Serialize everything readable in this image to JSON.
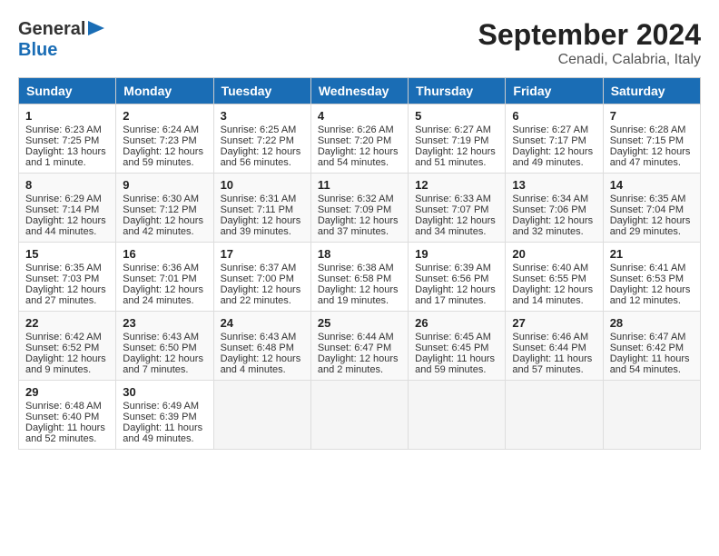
{
  "header": {
    "logo_line1": "General",
    "logo_line2": "Blue",
    "title": "September 2024",
    "subtitle": "Cenadi, Calabria, Italy"
  },
  "calendar": {
    "days_of_week": [
      "Sunday",
      "Monday",
      "Tuesday",
      "Wednesday",
      "Thursday",
      "Friday",
      "Saturday"
    ],
    "weeks": [
      [
        {
          "day": "1",
          "sunrise": "Sunrise: 6:23 AM",
          "sunset": "Sunset: 7:25 PM",
          "daylight": "Daylight: 13 hours and 1 minute."
        },
        {
          "day": "2",
          "sunrise": "Sunrise: 6:24 AM",
          "sunset": "Sunset: 7:23 PM",
          "daylight": "Daylight: 12 hours and 59 minutes."
        },
        {
          "day": "3",
          "sunrise": "Sunrise: 6:25 AM",
          "sunset": "Sunset: 7:22 PM",
          "daylight": "Daylight: 12 hours and 56 minutes."
        },
        {
          "day": "4",
          "sunrise": "Sunrise: 6:26 AM",
          "sunset": "Sunset: 7:20 PM",
          "daylight": "Daylight: 12 hours and 54 minutes."
        },
        {
          "day": "5",
          "sunrise": "Sunrise: 6:27 AM",
          "sunset": "Sunset: 7:19 PM",
          "daylight": "Daylight: 12 hours and 51 minutes."
        },
        {
          "day": "6",
          "sunrise": "Sunrise: 6:27 AM",
          "sunset": "Sunset: 7:17 PM",
          "daylight": "Daylight: 12 hours and 49 minutes."
        },
        {
          "day": "7",
          "sunrise": "Sunrise: 6:28 AM",
          "sunset": "Sunset: 7:15 PM",
          "daylight": "Daylight: 12 hours and 47 minutes."
        }
      ],
      [
        {
          "day": "8",
          "sunrise": "Sunrise: 6:29 AM",
          "sunset": "Sunset: 7:14 PM",
          "daylight": "Daylight: 12 hours and 44 minutes."
        },
        {
          "day": "9",
          "sunrise": "Sunrise: 6:30 AM",
          "sunset": "Sunset: 7:12 PM",
          "daylight": "Daylight: 12 hours and 42 minutes."
        },
        {
          "day": "10",
          "sunrise": "Sunrise: 6:31 AM",
          "sunset": "Sunset: 7:11 PM",
          "daylight": "Daylight: 12 hours and 39 minutes."
        },
        {
          "day": "11",
          "sunrise": "Sunrise: 6:32 AM",
          "sunset": "Sunset: 7:09 PM",
          "daylight": "Daylight: 12 hours and 37 minutes."
        },
        {
          "day": "12",
          "sunrise": "Sunrise: 6:33 AM",
          "sunset": "Sunset: 7:07 PM",
          "daylight": "Daylight: 12 hours and 34 minutes."
        },
        {
          "day": "13",
          "sunrise": "Sunrise: 6:34 AM",
          "sunset": "Sunset: 7:06 PM",
          "daylight": "Daylight: 12 hours and 32 minutes."
        },
        {
          "day": "14",
          "sunrise": "Sunrise: 6:35 AM",
          "sunset": "Sunset: 7:04 PM",
          "daylight": "Daylight: 12 hours and 29 minutes."
        }
      ],
      [
        {
          "day": "15",
          "sunrise": "Sunrise: 6:35 AM",
          "sunset": "Sunset: 7:03 PM",
          "daylight": "Daylight: 12 hours and 27 minutes."
        },
        {
          "day": "16",
          "sunrise": "Sunrise: 6:36 AM",
          "sunset": "Sunset: 7:01 PM",
          "daylight": "Daylight: 12 hours and 24 minutes."
        },
        {
          "day": "17",
          "sunrise": "Sunrise: 6:37 AM",
          "sunset": "Sunset: 7:00 PM",
          "daylight": "Daylight: 12 hours and 22 minutes."
        },
        {
          "day": "18",
          "sunrise": "Sunrise: 6:38 AM",
          "sunset": "Sunset: 6:58 PM",
          "daylight": "Daylight: 12 hours and 19 minutes."
        },
        {
          "day": "19",
          "sunrise": "Sunrise: 6:39 AM",
          "sunset": "Sunset: 6:56 PM",
          "daylight": "Daylight: 12 hours and 17 minutes."
        },
        {
          "day": "20",
          "sunrise": "Sunrise: 6:40 AM",
          "sunset": "Sunset: 6:55 PM",
          "daylight": "Daylight: 12 hours and 14 minutes."
        },
        {
          "day": "21",
          "sunrise": "Sunrise: 6:41 AM",
          "sunset": "Sunset: 6:53 PM",
          "daylight": "Daylight: 12 hours and 12 minutes."
        }
      ],
      [
        {
          "day": "22",
          "sunrise": "Sunrise: 6:42 AM",
          "sunset": "Sunset: 6:52 PM",
          "daylight": "Daylight: 12 hours and 9 minutes."
        },
        {
          "day": "23",
          "sunrise": "Sunrise: 6:43 AM",
          "sunset": "Sunset: 6:50 PM",
          "daylight": "Daylight: 12 hours and 7 minutes."
        },
        {
          "day": "24",
          "sunrise": "Sunrise: 6:43 AM",
          "sunset": "Sunset: 6:48 PM",
          "daylight": "Daylight: 12 hours and 4 minutes."
        },
        {
          "day": "25",
          "sunrise": "Sunrise: 6:44 AM",
          "sunset": "Sunset: 6:47 PM",
          "daylight": "Daylight: 12 hours and 2 minutes."
        },
        {
          "day": "26",
          "sunrise": "Sunrise: 6:45 AM",
          "sunset": "Sunset: 6:45 PM",
          "daylight": "Daylight: 11 hours and 59 minutes."
        },
        {
          "day": "27",
          "sunrise": "Sunrise: 6:46 AM",
          "sunset": "Sunset: 6:44 PM",
          "daylight": "Daylight: 11 hours and 57 minutes."
        },
        {
          "day": "28",
          "sunrise": "Sunrise: 6:47 AM",
          "sunset": "Sunset: 6:42 PM",
          "daylight": "Daylight: 11 hours and 54 minutes."
        }
      ],
      [
        {
          "day": "29",
          "sunrise": "Sunrise: 6:48 AM",
          "sunset": "Sunset: 6:40 PM",
          "daylight": "Daylight: 11 hours and 52 minutes."
        },
        {
          "day": "30",
          "sunrise": "Sunrise: 6:49 AM",
          "sunset": "Sunset: 6:39 PM",
          "daylight": "Daylight: 11 hours and 49 minutes."
        },
        null,
        null,
        null,
        null,
        null
      ]
    ]
  }
}
